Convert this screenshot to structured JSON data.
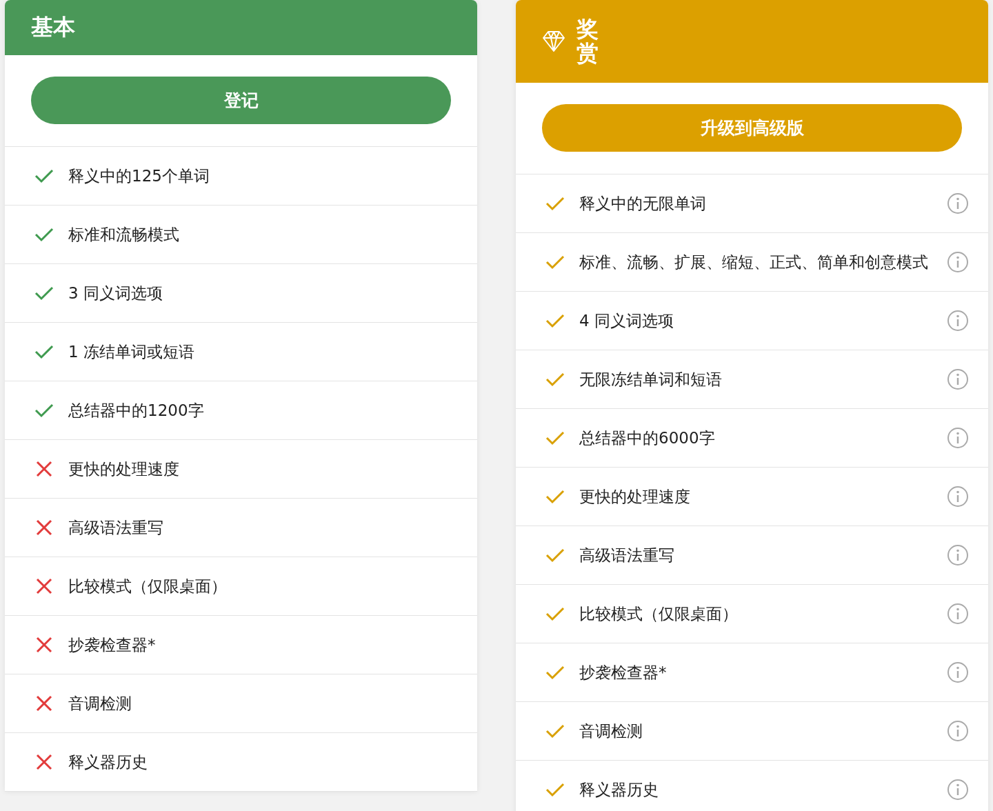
{
  "plans": [
    {
      "kind": "basic",
      "title": "基本",
      "button": "登记",
      "features": [
        {
          "text": "释义中的125个单词",
          "included": true,
          "info": false
        },
        {
          "text": "标准和流畅模式",
          "included": true,
          "info": false
        },
        {
          "text": "3 同义词选项",
          "included": true,
          "info": false
        },
        {
          "text": "1 冻结单词或短语",
          "included": true,
          "info": false
        },
        {
          "text": "总结器中的1200字",
          "included": true,
          "info": false
        },
        {
          "text": "更快的处理速度",
          "included": false,
          "info": false
        },
        {
          "text": "高级语法重写",
          "included": false,
          "info": false
        },
        {
          "text": "比较模式（仅限桌面）",
          "included": false,
          "info": false
        },
        {
          "text": "抄袭检查器*",
          "included": false,
          "info": false
        },
        {
          "text": "音调检测",
          "included": false,
          "info": false
        },
        {
          "text": "释义器历史",
          "included": false,
          "info": false
        }
      ]
    },
    {
      "kind": "premium",
      "title": "奖赏",
      "button": "升级到高级版",
      "features": [
        {
          "text": "释义中的无限单词",
          "included": true,
          "info": true
        },
        {
          "text": "标准、流畅、扩展、缩短、正式、简单和创意模式",
          "included": true,
          "info": true
        },
        {
          "text": "4 同义词选项",
          "included": true,
          "info": true
        },
        {
          "text": "无限冻结单词和短语",
          "included": true,
          "info": true
        },
        {
          "text": "总结器中的6000字",
          "included": true,
          "info": true
        },
        {
          "text": "更快的处理速度",
          "included": true,
          "info": true
        },
        {
          "text": "高级语法重写",
          "included": true,
          "info": true
        },
        {
          "text": "比较模式（仅限桌面）",
          "included": true,
          "info": true
        },
        {
          "text": "抄袭检查器*",
          "included": true,
          "info": true
        },
        {
          "text": "音调检测",
          "included": true,
          "info": true
        },
        {
          "text": "释义器历史",
          "included": true,
          "info": true
        }
      ]
    }
  ]
}
